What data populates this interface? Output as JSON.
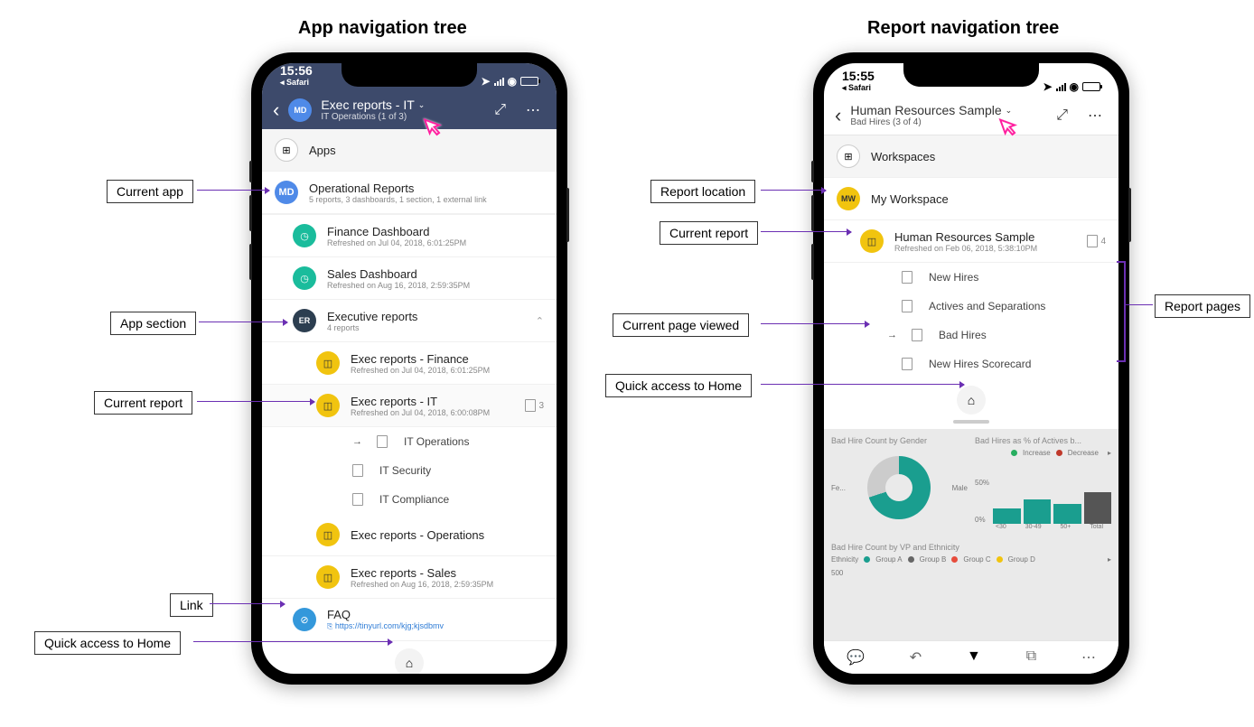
{
  "titles": {
    "left": "App navigation tree",
    "right": "Report navigation tree"
  },
  "left_phone": {
    "status": {
      "time": "15:56",
      "back": "◂ Safari"
    },
    "header": {
      "avatar": "MD",
      "title": "Exec reports - IT",
      "subtitle": "IT Operations (1 of 3)"
    },
    "apps_label": "Apps",
    "current_app": {
      "avatar": "MD",
      "title": "Operational Reports",
      "subtitle": "5 reports, 3 dashboards, 1 section, 1 external link"
    },
    "dashboards": [
      {
        "title": "Finance Dashboard",
        "subtitle": "Refreshed on Jul 04, 2018, 6:01:25PM",
        "color": "#1abc9c"
      },
      {
        "title": "Sales Dashboard",
        "subtitle": "Refreshed on Aug 16, 2018, 2:59:35PM",
        "color": "#1abc9c"
      }
    ],
    "section": {
      "avatar": "ER",
      "title": "Executive reports",
      "subtitle": "4 reports"
    },
    "reports": [
      {
        "title": "Exec reports - Finance",
        "subtitle": "Refreshed on Jul 04, 2018, 6:01:25PM"
      },
      {
        "title": "Exec reports - IT",
        "subtitle": "Refreshed on Jul 04, 2018, 6:00:08PM",
        "current": true,
        "count": "3",
        "pages": [
          {
            "title": "IT Operations",
            "current": true
          },
          {
            "title": "IT Security"
          },
          {
            "title": "IT Compliance"
          }
        ]
      },
      {
        "title": "Exec reports - Operations",
        "subtitle": ""
      },
      {
        "title": "Exec reports - Sales",
        "subtitle": "Refreshed on Aug 16, 2018, 2:59:35PM"
      }
    ],
    "link": {
      "title": "FAQ",
      "url": "https://tinyurl.com/kjg;kjsdbmv"
    }
  },
  "right_phone": {
    "status": {
      "time": "15:55",
      "back": "◂ Safari"
    },
    "header": {
      "title": "Human Resources Sample",
      "subtitle": "Bad Hires (3 of 4)"
    },
    "workspaces_label": "Workspaces",
    "workspace": {
      "avatar": "MW",
      "title": "My Workspace"
    },
    "report": {
      "title": "Human Resources Sample",
      "subtitle": "Refreshed on Feb 06, 2018, 5:38:10PM",
      "count": "4"
    },
    "pages": [
      {
        "title": "New Hires"
      },
      {
        "title": "Actives and Separations"
      },
      {
        "title": "Bad Hires",
        "current": true
      },
      {
        "title": "New Hires Scorecard"
      }
    ],
    "preview": {
      "chart1_title": "Bad Hire Count by Gender",
      "chart2_title": "Bad Hires as % of Actives b...",
      "gender_labels": {
        "female": "Fe...",
        "male": "Male"
      },
      "legend_inc": "Increase",
      "legend_dec": "Decrease",
      "pct_label": "50%",
      "pct_label2": "0%",
      "x_labels": [
        "<30",
        "30-49",
        "50+",
        "Total"
      ],
      "chart3_title": "Bad Hire Count by VP and Ethnicity",
      "ethnicity_label": "Ethnicity",
      "groups": [
        {
          "name": "Group A",
          "color": "#1a9e8f"
        },
        {
          "name": "Group B",
          "color": "#666"
        },
        {
          "name": "Group C",
          "color": "#e74c3c"
        },
        {
          "name": "Group D",
          "color": "#f1c40f"
        }
      ],
      "y_label": "500"
    }
  },
  "callouts": {
    "current_app": "Current app",
    "app_section": "App section",
    "current_report": "Current report",
    "link": "Link",
    "quick_home": "Quick access to Home",
    "report_location": "Report location",
    "current_report2": "Current report",
    "current_page": "Current page viewed",
    "quick_home2": "Quick access to Home",
    "report_pages": "Report pages"
  }
}
